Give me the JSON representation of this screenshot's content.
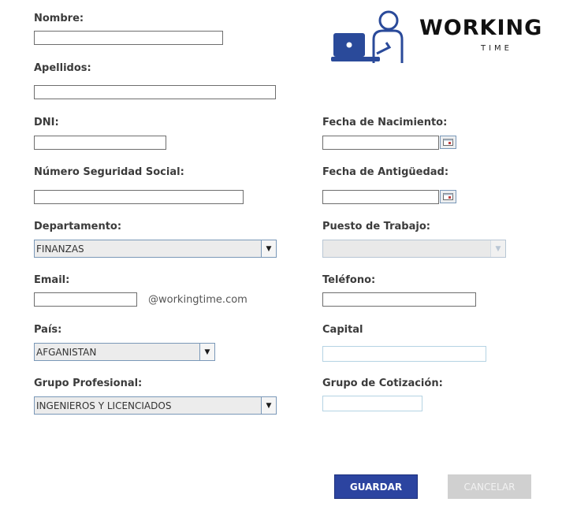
{
  "brand": {
    "name": "WORKING",
    "sub": "TIME"
  },
  "form": {
    "nombre": {
      "label": "Nombre:",
      "value": ""
    },
    "apellidos": {
      "label": "Apellidos:",
      "value": ""
    },
    "dni": {
      "label": "DNI:",
      "value": ""
    },
    "fecha_nacimiento": {
      "label": "Fecha de Nacimiento:",
      "value": ""
    },
    "nss": {
      "label": "Número Seguridad Social:",
      "value": ""
    },
    "fecha_antiguedad": {
      "label": "Fecha de Antigüedad:",
      "value": ""
    },
    "departamento": {
      "label": "Departamento:",
      "value": "FINANZAS"
    },
    "puesto": {
      "label": "Puesto de Trabajo:",
      "value": ""
    },
    "email": {
      "label": "Email:",
      "value": "",
      "suffix": "@workingtime.com"
    },
    "telefono": {
      "label": "Teléfono:",
      "value": ""
    },
    "pais": {
      "label": "País:",
      "value": "AFGANISTAN"
    },
    "capital": {
      "label": "Capital",
      "value": ""
    },
    "grupo_profesional": {
      "label": "Grupo Profesional:",
      "value": "INGENIEROS Y LICENCIADOS"
    },
    "grupo_cotizacion": {
      "label": "Grupo de Cotización:",
      "value": ""
    }
  },
  "buttons": {
    "save": "GUARDAR",
    "cancel": "CANCELAR"
  },
  "colors": {
    "primary": "#2c44a0",
    "logo_blue": "#2a4a9a"
  }
}
